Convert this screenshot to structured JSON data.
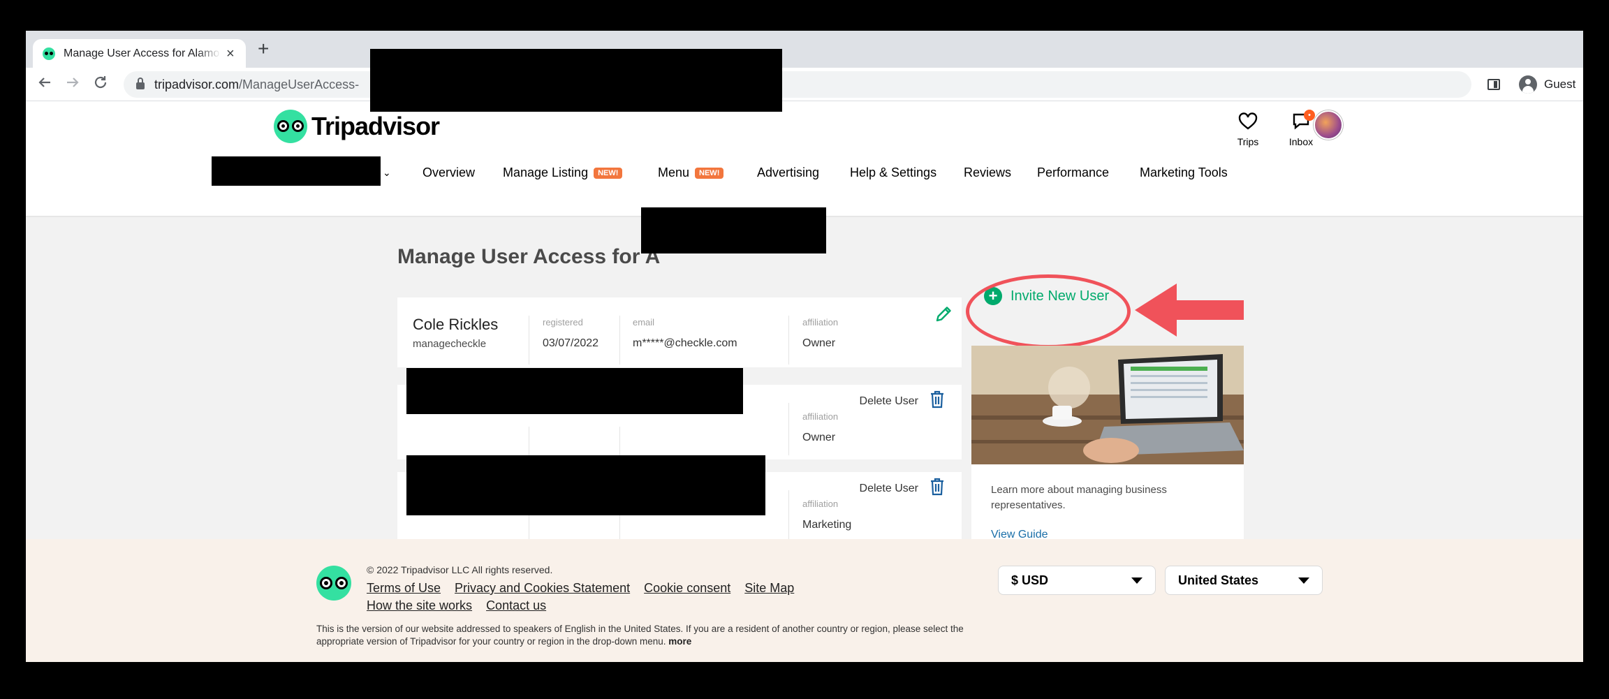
{
  "browser": {
    "tab_title": "Manage User Access for Alamo",
    "tab_close": "×",
    "new_tab": "+",
    "url_host": "tripadvisor.com",
    "url_path": "/ManageUserAccess-",
    "profile_label": "Guest"
  },
  "header": {
    "logo_text": "Tripadvisor",
    "trips_label": "Trips",
    "inbox_label": "Inbox",
    "inbox_badge": "•"
  },
  "nav": {
    "chevron": "⌄",
    "items": [
      {
        "label": "Overview"
      },
      {
        "label": "Manage Listing",
        "badge": "NEW!"
      },
      {
        "label": "Menu",
        "badge": "NEW!"
      },
      {
        "label": "Advertising"
      },
      {
        "label": "Help & Settings"
      },
      {
        "label": "Reviews"
      },
      {
        "label": "Performance"
      },
      {
        "label": "Marketing Tools"
      }
    ]
  },
  "page": {
    "title": "Manage User Access for A"
  },
  "users": [
    {
      "name": "Cole Rickles",
      "username": "managecheckle",
      "registered_label": "registered",
      "registered": "03/07/2022",
      "email_label": "email",
      "email": "m*****@checkle.com",
      "affiliation_label": "affiliation",
      "affiliation": "Owner"
    },
    {
      "delete_label": "Delete User",
      "affiliation_label": "affiliation",
      "affiliation": "Owner"
    },
    {
      "delete_label": "Delete User",
      "affiliation_label": "affiliation",
      "affiliation": "Marketing"
    }
  ],
  "invite": {
    "icon": "+",
    "label": "Invite New User"
  },
  "promo": {
    "text": "Learn more about managing business representatives.",
    "link": "View Guide"
  },
  "footer": {
    "copyright": "© 2022 Tripadvisor LLC All rights reserved.",
    "links": [
      "Terms of Use",
      "Privacy and Cookies Statement",
      "Cookie consent",
      "Site Map",
      "How the site works",
      "Contact us"
    ],
    "disclaimer": "This is the version of our website addressed to speakers of English in the United States. If you are a resident of another country or region, please select the appropriate version of Tripadvisor for your country or region in the drop-down menu.",
    "more": "more",
    "currency": "$ USD",
    "country": "United States"
  },
  "colors": {
    "brand_green": "#34e0a1",
    "action_green": "#00aa6c",
    "annotation_red": "#f0525a",
    "badge_orange": "#f2763d",
    "link_blue": "#1a6ea8"
  },
  "icons": [
    "favicon-owl-icon",
    "back-arrow-icon",
    "forward-arrow-icon",
    "reload-icon",
    "lock-icon",
    "side-panel-icon",
    "guest-profile-icon",
    "heart-icon",
    "chat-bubble-icon",
    "pencil-icon",
    "trash-icon",
    "plus-circle-icon"
  ]
}
